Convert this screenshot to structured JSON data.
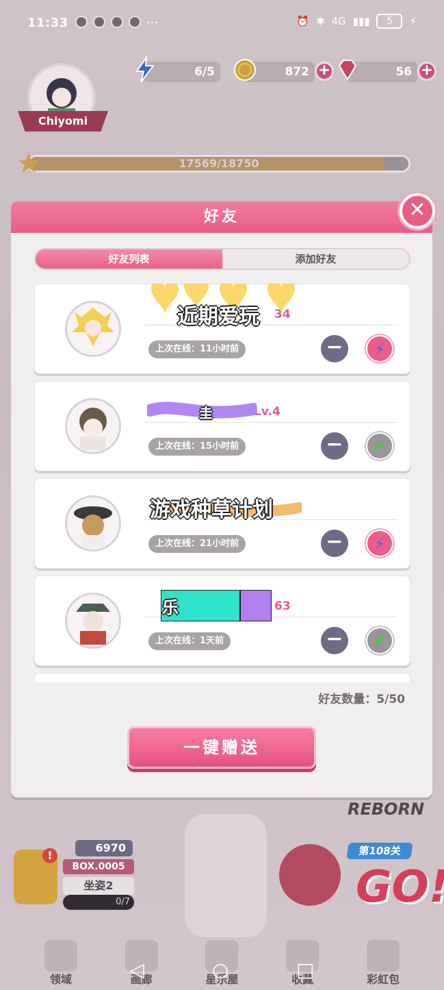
{
  "status_bar": {
    "time": "11:33",
    "more": "···",
    "network": "4G",
    "battery": "5"
  },
  "hud": {
    "energy": "6/5",
    "coins": "872",
    "gems": "56",
    "player_name": "Chiyomi",
    "xp_text": "17569/18750",
    "xp_fraction": 0.937
  },
  "modal": {
    "title": "好友",
    "tabs": [
      {
        "label": "好友列表",
        "active": true
      },
      {
        "label": "添加好友",
        "active": false
      }
    ],
    "friends": [
      {
        "name_overlay": "近期爱玩",
        "level": "34",
        "last_online": "上次在线：11小时前",
        "action": "gift"
      },
      {
        "name_overlay": "圭",
        "level": "Lv.4",
        "last_online": "上次在线：15小时前",
        "action": "done"
      },
      {
        "name_overlay": "游戏种草计划",
        "level": "",
        "last_online": "上次在线：21小时前",
        "action": "gift"
      },
      {
        "name_overlay": "乐",
        "level": "63",
        "last_online": "上次在线：1天前",
        "action": "done"
      }
    ],
    "friend_count": "好友数量：5/50",
    "send_all": "一键赠送"
  },
  "lower": {
    "gem_count": "6970",
    "box_label": "BOX.0005",
    "pose_label": "坐姿2",
    "pose_progress": "0/7",
    "reborn": "REBORN",
    "level_tag": "第108关",
    "go": "GO!"
  },
  "nav": [
    {
      "label": "领域"
    },
    {
      "label": "画廊"
    },
    {
      "label": "星乐屋"
    },
    {
      "label": "收藏"
    },
    {
      "label": "彩虹包"
    }
  ],
  "colors": {
    "accent": "#e85e87",
    "level": "#e05c88",
    "check": "#3ecf3e"
  }
}
